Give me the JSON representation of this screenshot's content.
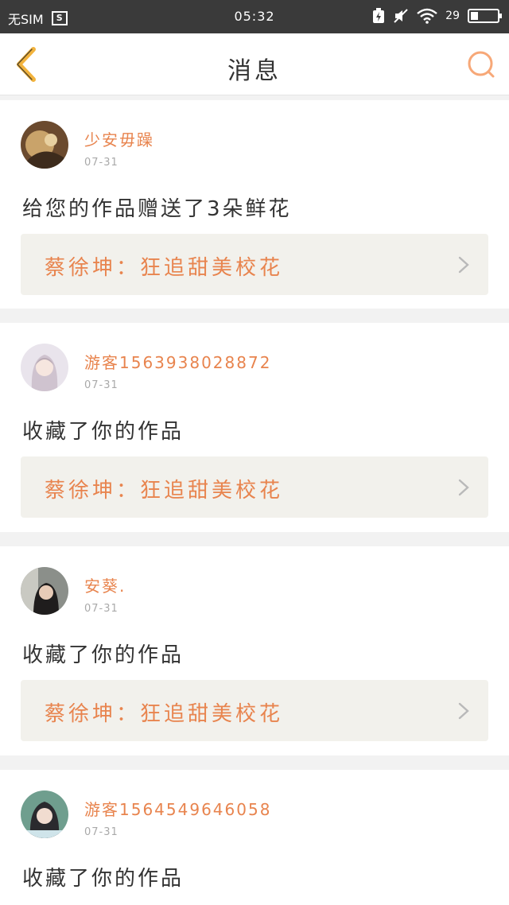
{
  "status_bar": {
    "sim": "无SIM",
    "sim_icon": "S",
    "time": "05:32",
    "battery": "29"
  },
  "nav": {
    "back_icon": "chevron-left-icon",
    "title": "消息",
    "search_icon": "search-icon"
  },
  "colors": {
    "accent": "#e8844e",
    "back": "#f2b33d",
    "search": "#f7a878"
  },
  "messages": [
    {
      "user": "少安毋躁",
      "date": "07-31",
      "action": "给您的作品赠送了3朵鲜花",
      "work": "蔡徐坤：狂追甜美校花"
    },
    {
      "user": "游客1563938028872",
      "date": "07-31",
      "action": "收藏了你的作品",
      "work": "蔡徐坤：狂追甜美校花"
    },
    {
      "user": "安葵.",
      "date": "07-31",
      "action": "收藏了你的作品",
      "work": "蔡徐坤：狂追甜美校花"
    },
    {
      "user": "游客1564549646058",
      "date": "07-31",
      "action": "收藏了你的作品",
      "work": ""
    }
  ]
}
